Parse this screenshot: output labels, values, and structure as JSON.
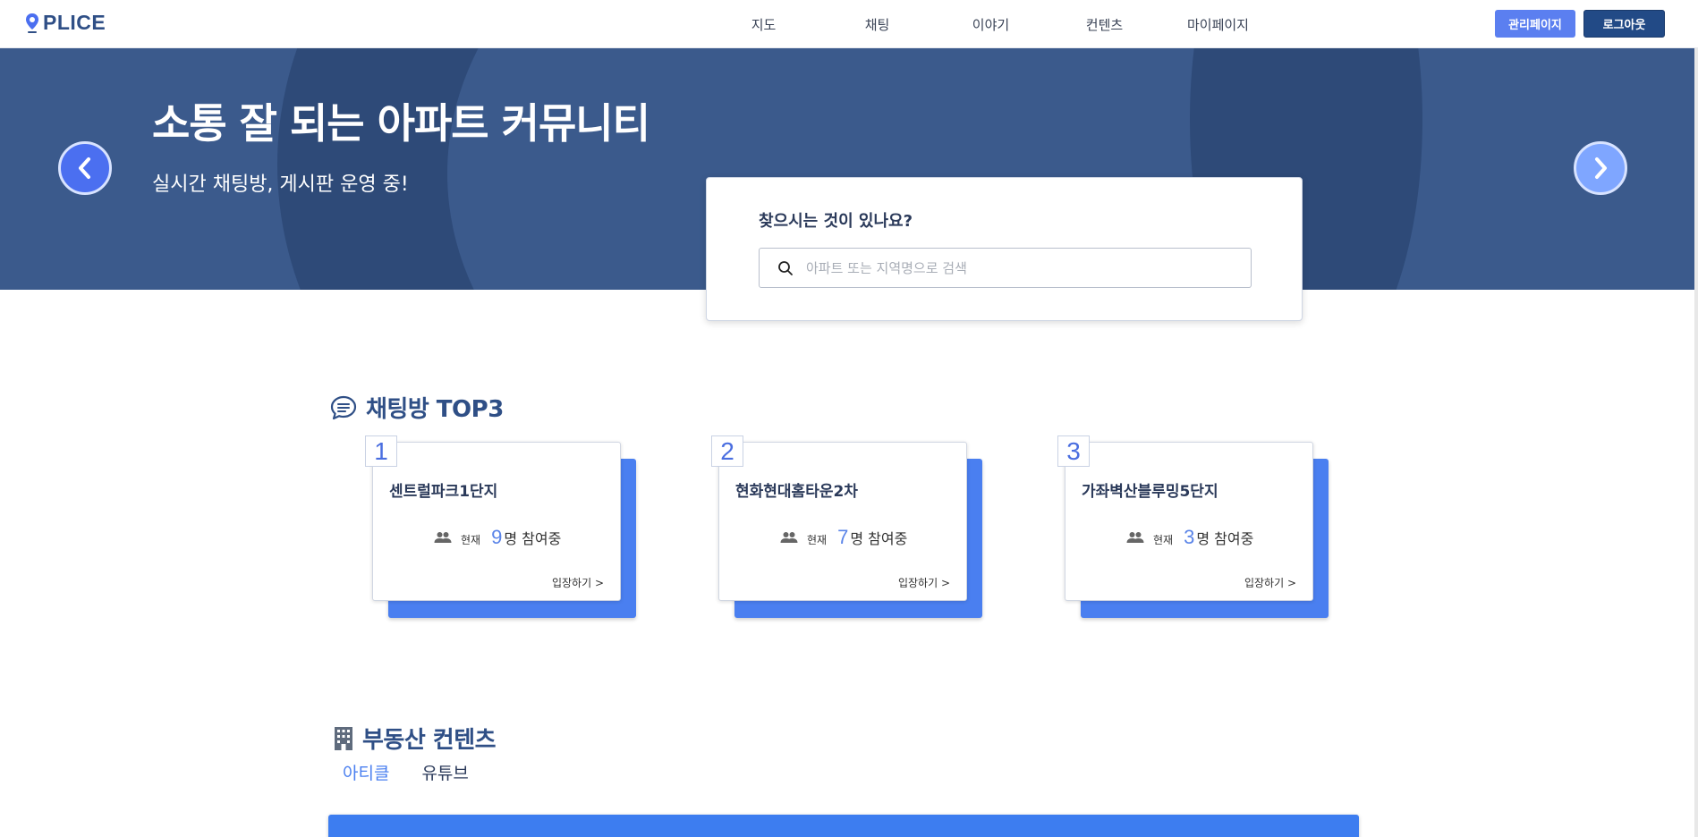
{
  "header": {
    "logo_text": "PLICE",
    "nav": [
      "지도",
      "채팅",
      "이야기",
      "컨텐츠",
      "마이페이지"
    ],
    "admin_label": "관리페이지",
    "logout_label": "로그아웃"
  },
  "hero": {
    "title": "소통 잘 되는 아파트 커뮤니티",
    "subtitle": "실시간 채팅방, 게시판 운영 중!"
  },
  "search": {
    "title": "찾으시는 것이 있나요?",
    "placeholder": "아파트 또는 지역명으로 검색"
  },
  "chat_section": {
    "title": "채팅방 TOP3",
    "cards": [
      {
        "rank": "1",
        "name": "센트럴파크1단지",
        "label": "현재",
        "count": "9",
        "suffix": "명 참여중",
        "enter": "입장하기 >"
      },
      {
        "rank": "2",
        "name": "현화현대홈타운2차",
        "label": "현재",
        "count": "7",
        "suffix": "명 참여중",
        "enter": "입장하기 >"
      },
      {
        "rank": "3",
        "name": "가좌벽산블루밍5단지",
        "label": "현재",
        "count": "3",
        "suffix": "명 참여중",
        "enter": "입장하기 >"
      }
    ]
  },
  "content_section": {
    "title": "부동산 컨텐츠",
    "tabs": [
      "아티클",
      "유튜브"
    ],
    "active_tab": "아티클"
  },
  "colors": {
    "brand": "#2f4f86",
    "accent": "#4a7ff0",
    "hero_bg": "#3b5a8c"
  }
}
